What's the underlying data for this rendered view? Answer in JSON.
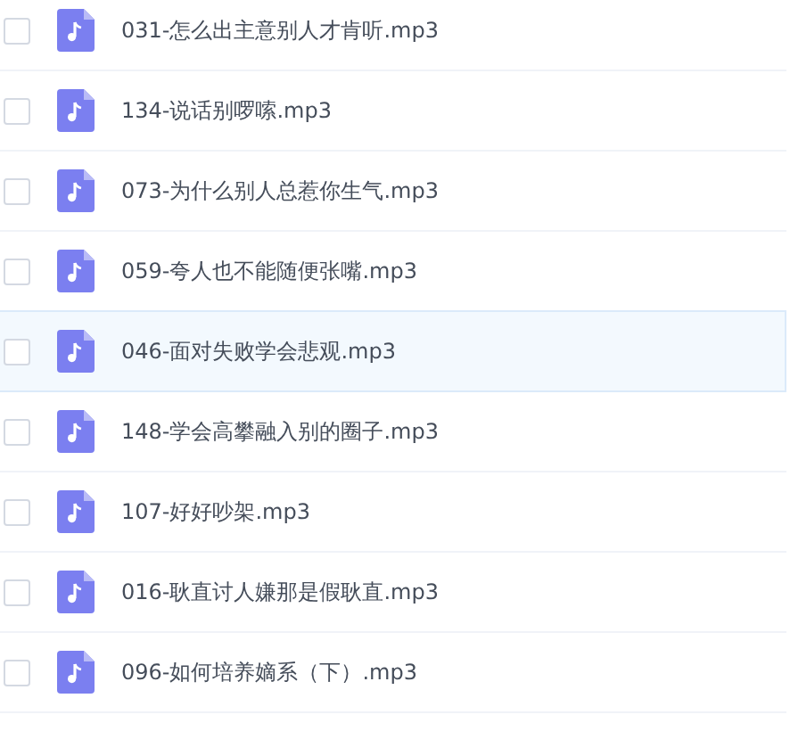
{
  "files": [
    {
      "name": "031-怎么出主意别人才肯听.mp3",
      "checked": false,
      "highlighted": false
    },
    {
      "name": "134-说话别啰嗦.mp3",
      "checked": false,
      "highlighted": false
    },
    {
      "name": "073-为什么别人总惹你生气.mp3",
      "checked": false,
      "highlighted": false
    },
    {
      "name": "059-夸人也不能随便张嘴.mp3",
      "checked": false,
      "highlighted": false
    },
    {
      "name": "046-面对失败学会悲观.mp3",
      "checked": false,
      "highlighted": true
    },
    {
      "name": "148-学会高攀融入别的圈子.mp3",
      "checked": false,
      "highlighted": false
    },
    {
      "name": "107-好好吵架.mp3",
      "checked": false,
      "highlighted": false
    },
    {
      "name": "016-耿直讨人嫌那是假耿直.mp3",
      "checked": false,
      "highlighted": false
    },
    {
      "name": "096-如何培养嫡系（下）.mp3",
      "checked": false,
      "highlighted": false
    }
  ]
}
